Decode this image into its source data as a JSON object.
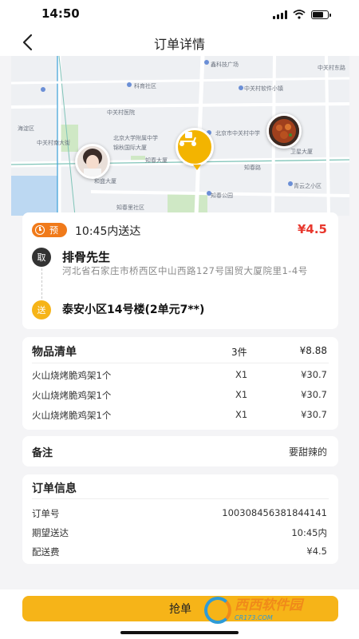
{
  "status_bar": {
    "time": "14:50"
  },
  "nav": {
    "title": "订单详情"
  },
  "map": {
    "labels": [
      "鑫科技广场",
      "科育社区",
      "中关村东路",
      "中关村软件小镇",
      "海淀区",
      "中关村医院",
      "中关村南大街",
      "北京大学附属中学",
      "北京市中关村中学",
      "知春路",
      "知春大厦",
      "和盛大厦",
      "锦秋国际大厦",
      "知春里社区",
      "知春公园",
      "青云之小区",
      "卫星大厦"
    ]
  },
  "order": {
    "pre_badge": "预",
    "delivery_time": "10:45内送达",
    "fee": "¥4.5",
    "pickup_tag": "取",
    "shop_name": "排骨先生",
    "shop_address": "河北省石家庄市桥西区中山西路127号国贸大厦院里1-4号",
    "dest_tag": "送",
    "destination": "泰安小区14号楼(2单元7**)"
  },
  "items": {
    "header": "物品清单",
    "count": "3件",
    "total": "¥8.88",
    "rows": [
      {
        "name": "火山烧烤脆鸡架1个",
        "qty": "X1",
        "price": "¥30.7"
      },
      {
        "name": "火山烧烤脆鸡架1个",
        "qty": "X1",
        "price": "¥30.7"
      },
      {
        "name": "火山烧烤脆鸡架1个",
        "qty": "X1",
        "price": "¥30.7"
      }
    ]
  },
  "note": {
    "label": "备注",
    "value": "要甜辣的"
  },
  "info": {
    "header": "订单信息",
    "rows": [
      {
        "key": "订单号",
        "value": "100308456381844141"
      },
      {
        "key": "期望送达",
        "value": "10:45内"
      },
      {
        "key": "配送费",
        "value": "¥4.5"
      }
    ]
  },
  "action": {
    "grab_label": "抢单"
  },
  "watermark": {
    "brand": "西西软件园",
    "domain": "CR173.COM"
  },
  "colors": {
    "accent": "#f6b418",
    "price_red": "#e8382e",
    "badge_orange": "#f07a1a"
  }
}
